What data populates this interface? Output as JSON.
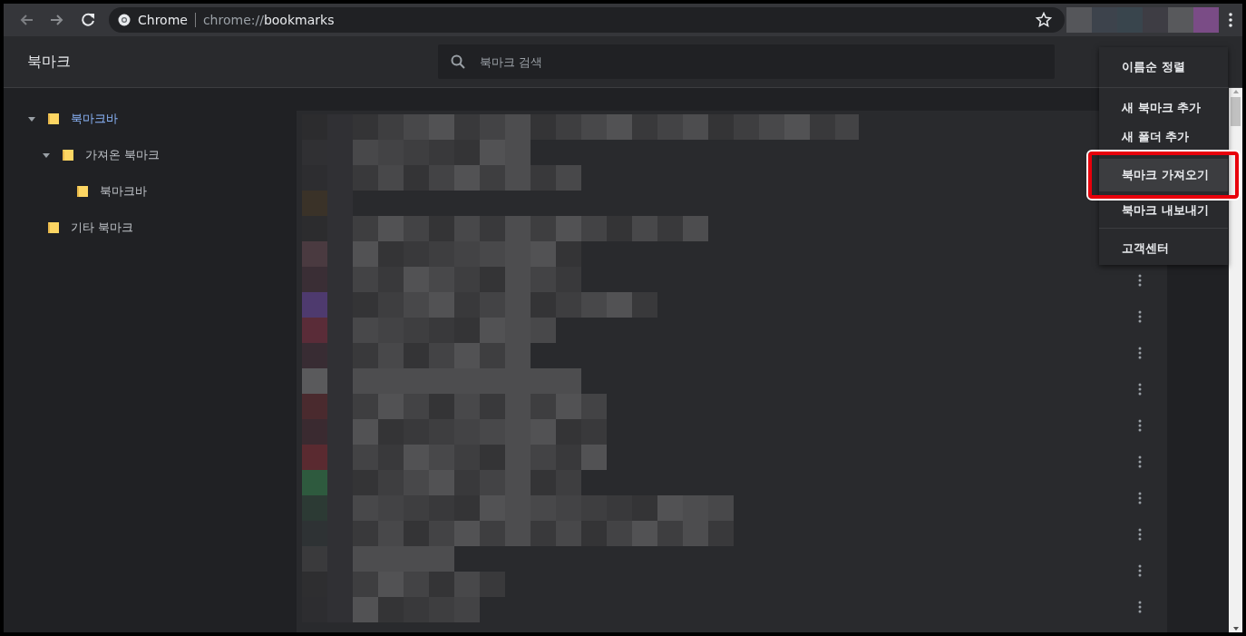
{
  "browser": {
    "site_label": "Chrome",
    "url_prefix": "chrome://",
    "url_host": "bookmarks"
  },
  "header": {
    "title": "북마크",
    "search": {
      "placeholder": "북마크 검색"
    }
  },
  "tree": [
    {
      "label": "북마크바",
      "selected": true,
      "expanded": true,
      "children": [
        {
          "label": "가져온 북마크",
          "selected": false,
          "expanded": true,
          "children": [
            {
              "label": "북마크바",
              "selected": false
            }
          ]
        }
      ]
    },
    {
      "label": "기타 북마크",
      "selected": false
    }
  ],
  "rows": [
    {
      "kind": "bookmark"
    },
    {
      "kind": "bookmark"
    },
    {
      "kind": "bookmark"
    },
    {
      "kind": "bookmark"
    },
    {
      "kind": "bookmark"
    },
    {
      "kind": "bookmark"
    },
    {
      "kind": "bookmark"
    },
    {
      "kind": "bookmark"
    },
    {
      "kind": "bookmark"
    },
    {
      "kind": "bookmark"
    }
  ],
  "menu": [
    {
      "kind": "item",
      "label": "이름순 정렬",
      "selected": false
    },
    {
      "kind": "divider"
    },
    {
      "kind": "item",
      "label": "새 북마크 추가",
      "selected": false
    },
    {
      "kind": "item",
      "label": "새 폴더 추가",
      "selected": false
    },
    {
      "kind": "item",
      "label": "북마크 가져오기",
      "selected": true
    },
    {
      "kind": "item",
      "label": "북마크 내보내기",
      "selected": false
    },
    {
      "kind": "divider"
    },
    {
      "kind": "item",
      "label": "고객센터",
      "selected": false
    }
  ]
}
